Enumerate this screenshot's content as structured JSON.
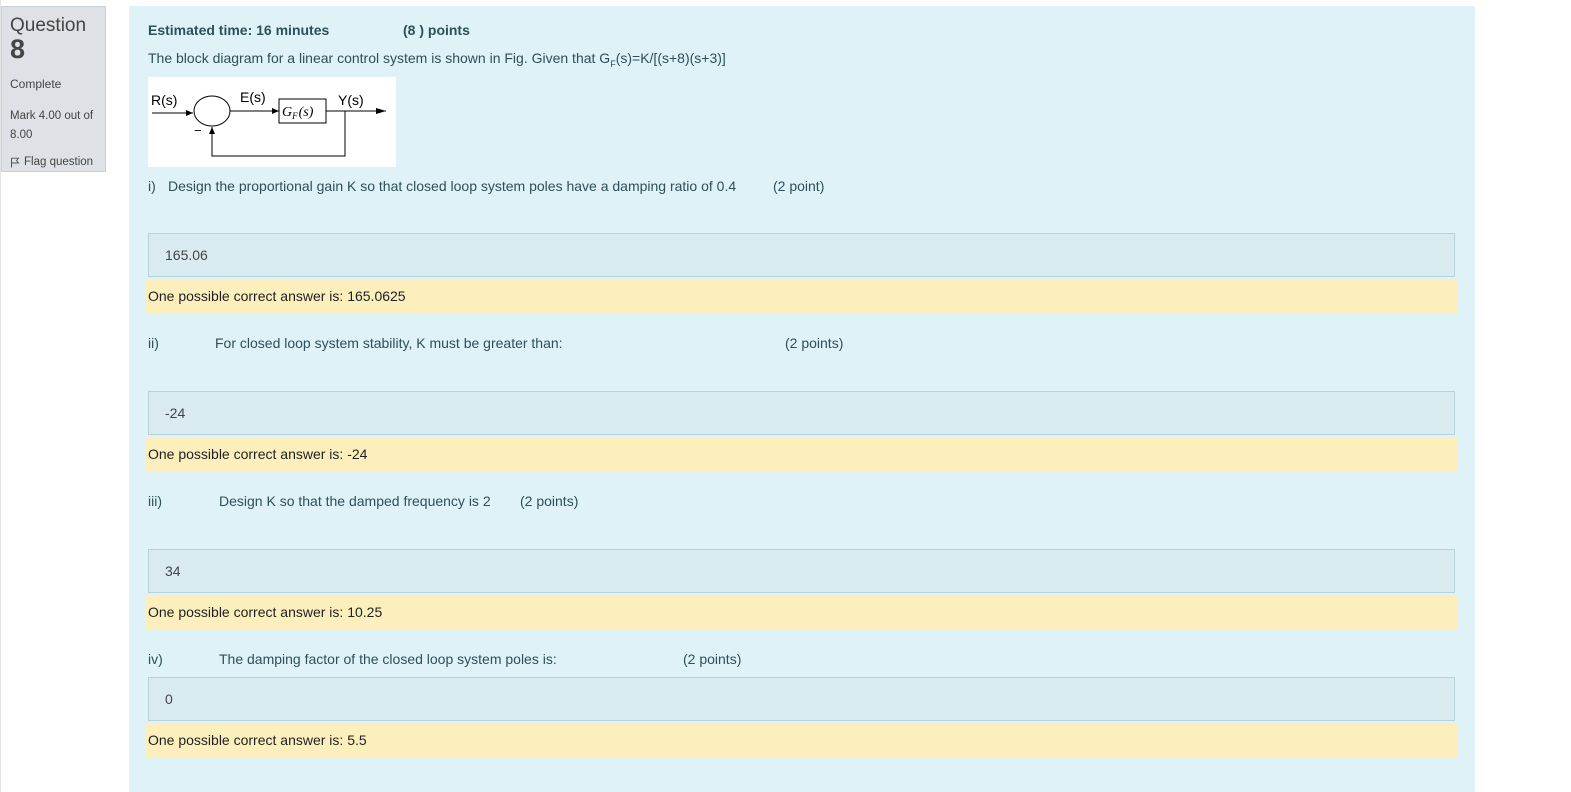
{
  "info": {
    "question_label": "Question",
    "question_number": "8",
    "state": "Complete",
    "grade_line1": "Mark 4.00 out of",
    "grade_line2": "8.00",
    "flag_label": "Flag question",
    "flag_icon": "flag-icon"
  },
  "header": {
    "time": "Estimated time: 16 minutes",
    "points": "(8 ) points",
    "intro": "The block diagram for a linear control system is shown in Fig. Given that G",
    "intro_sub": "F",
    "intro_end": "(s)=K/[(s+8)(s+3)]"
  },
  "diagram": {
    "input": "R(s)",
    "error": "E(s)",
    "output": "Y(s)",
    "block": "G",
    "block_sub": "F",
    "block_arg": "(s)",
    "minus": "−"
  },
  "parts": [
    {
      "label": "i)",
      "text": "Design the proportional gain K so that closed loop system poles have a damping ratio of 0.4",
      "points": "(2 point)",
      "answer": "165.06",
      "feedback": "One possible correct answer is: 165.0625"
    },
    {
      "label": "ii)",
      "text": "For closed loop system stability, K must be greater than:",
      "points": "(2 points)",
      "answer": "-24",
      "feedback": "One possible correct answer is: -24"
    },
    {
      "label": "iii)",
      "text": "Design K so that the damped frequency is 2",
      "points": "(2 points)",
      "answer": "34",
      "feedback": "One possible correct answer is: 10.25"
    },
    {
      "label": "iv)",
      "text": "The damping factor of the closed loop system poles is:",
      "points": "(2 points)",
      "answer": "0",
      "feedback": "One possible correct answer is: 5.5"
    }
  ]
}
